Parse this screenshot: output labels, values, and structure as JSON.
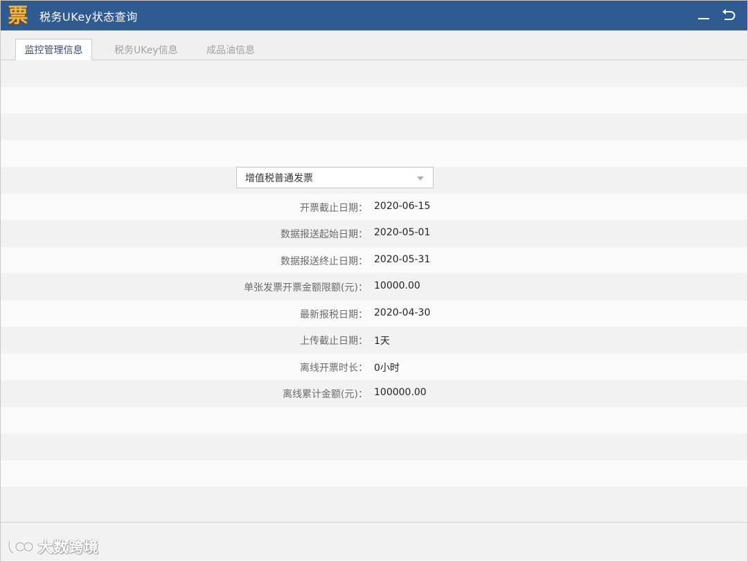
{
  "window": {
    "title": "税务UKey状态查询",
    "logo_glyph": "票",
    "logo_color": "#f0b640",
    "titlebar_color": "#2f5a92"
  },
  "tabs": [
    {
      "label": "监控管理信息",
      "active": true
    },
    {
      "label": "税务UKey信息",
      "active": false
    },
    {
      "label": "成品油信息",
      "active": false
    }
  ],
  "invoice_type": {
    "selected": "增值税普通发票",
    "icon": "chevron-down-icon"
  },
  "info": [
    {
      "label": "开票截止日期：",
      "value": "2020-06-15"
    },
    {
      "label": "数据报送起始日期：",
      "value": "2020-05-01"
    },
    {
      "label": "数据报送终止日期：",
      "value": "2020-05-31"
    },
    {
      "label": "单张发票开票金额限额(元)：",
      "value": "10000.00"
    },
    {
      "label": "最新报税日期：",
      "value": "2020-04-30"
    },
    {
      "label": "上传截止日期：",
      "value": "1天"
    },
    {
      "label": "离线开票时长：",
      "value": "0小时"
    },
    {
      "label": "离线累计金额(元)：",
      "value": "100000.00"
    }
  ],
  "watermark": {
    "text": "大数跨境",
    "icon": "brand-logo-icon"
  }
}
